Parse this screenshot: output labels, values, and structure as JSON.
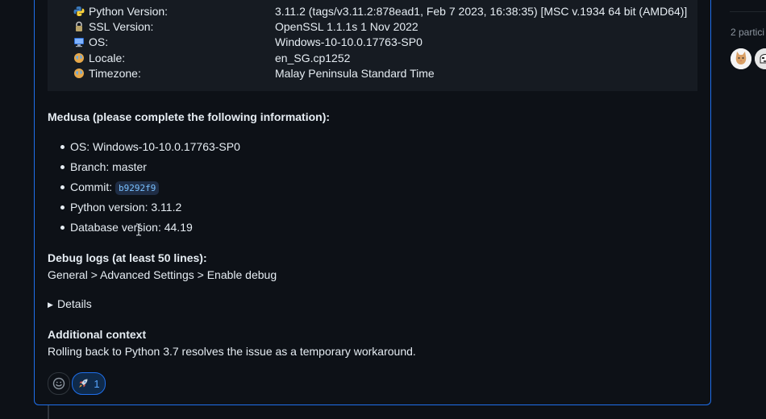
{
  "system_info": {
    "rows": [
      {
        "icon": "python-icon",
        "label": "Python Version:",
        "value": "3.11.2 (tags/v3.11.2:878ead1, Feb 7 2023, 16:38:35) [MSC v.1934 64 bit (AMD64)]"
      },
      {
        "icon": "lock-icon",
        "label": "SSL Version:",
        "value": "OpenSSL 1.1.1s 1 Nov 2022"
      },
      {
        "icon": "windows-icon",
        "label": "OS:",
        "value": "Windows-10-10.0.17763-SP0"
      },
      {
        "icon": "globe-icon",
        "label": "Locale:",
        "value": "en_SG.cp1252"
      },
      {
        "icon": "globe-icon",
        "label": "Timezone:",
        "value": "Malay Peninsula Standard Time"
      }
    ]
  },
  "medusa": {
    "heading": "Medusa (please complete the following information):",
    "items": [
      {
        "text": "OS: Windows-10-10.0.17763-SP0"
      },
      {
        "text": "Branch: master"
      },
      {
        "text": "Commit: ",
        "code": "b9292f9"
      },
      {
        "text": "Python version: 3.11.2"
      },
      {
        "text": "Database version: 44.19"
      }
    ]
  },
  "debug": {
    "heading": "Debug logs (at least 50 lines):",
    "path": "General > Advanced Settings > Enable debug"
  },
  "details": {
    "label": "Details"
  },
  "additional": {
    "heading": "Additional context",
    "text": "Rolling back to Python 3.7 resolves the issue as a temporary workaround."
  },
  "reactions": {
    "rocket_count": "1"
  },
  "sidebar": {
    "participants_label": "2 partici"
  },
  "colors": {
    "accent": "#1f6feb",
    "background": "#0d1117",
    "code_block": "#161b22"
  }
}
